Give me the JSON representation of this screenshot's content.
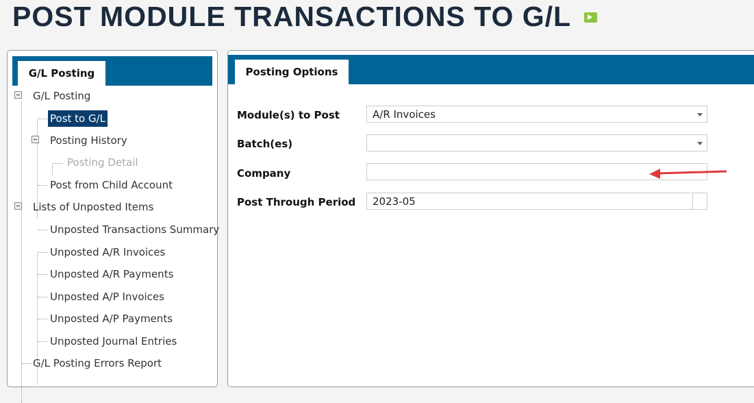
{
  "page": {
    "title": "POST MODULE TRANSACTIONS TO G/L",
    "help_icon": "video-tv-icon"
  },
  "left": {
    "tab": "G/L Posting",
    "tree": [
      {
        "label": "G/L Posting"
      },
      {
        "label": "Post to G/L"
      },
      {
        "label": "Posting History"
      },
      {
        "label": "Posting Detail"
      },
      {
        "label": "Post from Child Account"
      },
      {
        "label": "Lists of Unposted Items"
      },
      {
        "label": "Unposted Transactions Summary"
      },
      {
        "label": "Unposted A/R Invoices"
      },
      {
        "label": "Unposted A/R Payments"
      },
      {
        "label": "Unposted A/P Invoices"
      },
      {
        "label": "Unposted A/P Payments"
      },
      {
        "label": "Unposted Journal Entries"
      },
      {
        "label": "G/L Posting Errors Report"
      }
    ]
  },
  "right": {
    "tab": "Posting Options",
    "fields": [
      {
        "label": "Module(s) to Post",
        "value": "A/R Invoices"
      },
      {
        "label": "Batch(es)",
        "value": ""
      },
      {
        "label": "Company",
        "value": ""
      },
      {
        "label": "Post Through Period",
        "value": "2023-05"
      }
    ]
  },
  "colors": {
    "accent": "#006496",
    "selected": "#0a3d6b",
    "arrow": "#e03a3a"
  }
}
